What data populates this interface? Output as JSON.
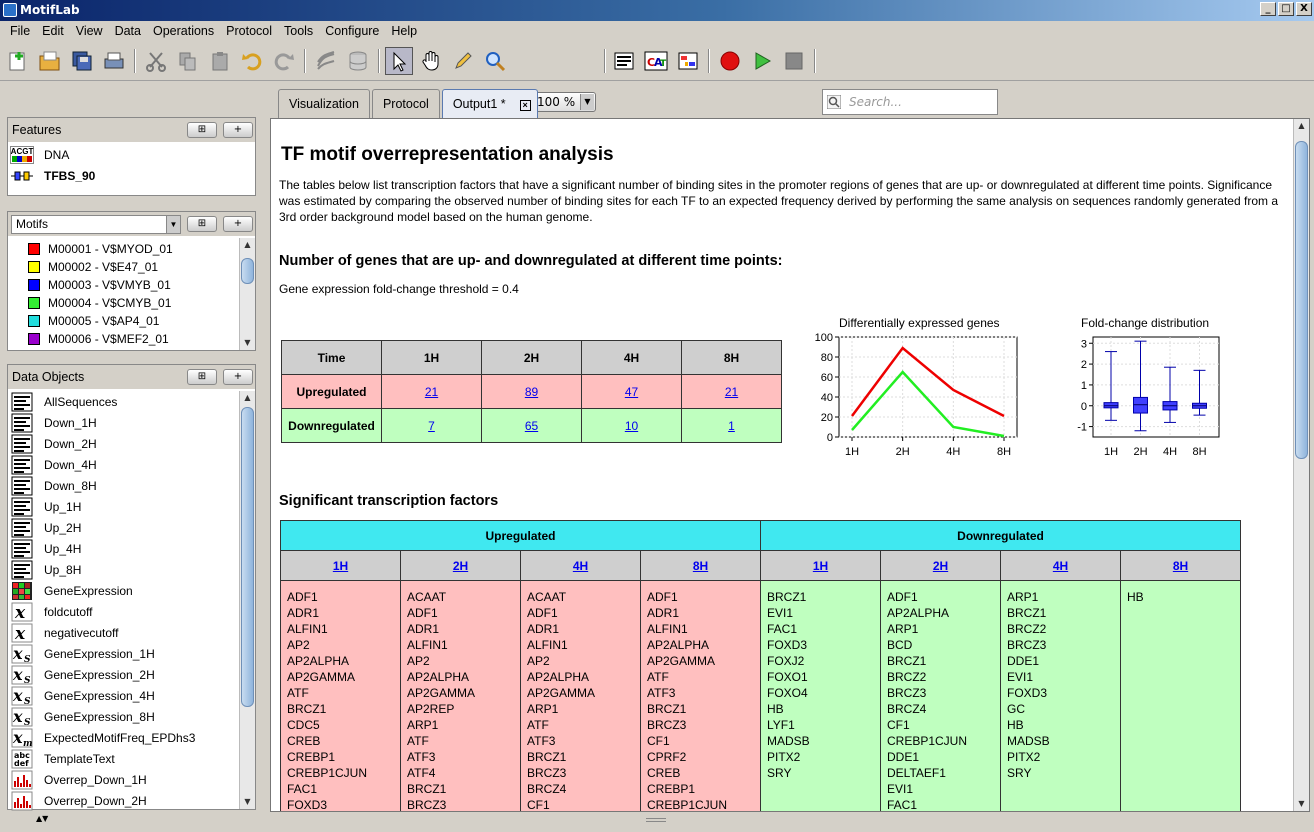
{
  "window": {
    "title": "MotifLab",
    "minimize": "_",
    "maximize": "□",
    "close": "X"
  },
  "menu": [
    "File",
    "Edit",
    "View",
    "Data",
    "Operations",
    "Protocol",
    "Tools",
    "Configure",
    "Help"
  ],
  "toolbar": {
    "zoom": "100 %",
    "search_placeholder": "Search..."
  },
  "features": {
    "title": "Features",
    "items": [
      {
        "label": "DNA",
        "icon": "dna-track-icon"
      },
      {
        "label": "TFBS_90",
        "icon": "region-track-icon"
      }
    ]
  },
  "motifs": {
    "selector": "Motifs",
    "items": [
      {
        "label": "M00001 - V$MYOD_01",
        "color": "#ff0000"
      },
      {
        "label": "M00002 - V$E47_01",
        "color": "#ffff00"
      },
      {
        "label": "M00003 - V$VMYB_01",
        "color": "#0000ff"
      },
      {
        "label": "M00004 - V$CMYB_01",
        "color": "#33ee33"
      },
      {
        "label": "M00005 - V$AP4_01",
        "color": "#22dddd"
      },
      {
        "label": "M00006 - V$MEF2_01",
        "color": "#9900cc"
      }
    ]
  },
  "data_objects": {
    "title": "Data Objects",
    "items": [
      {
        "label": "AllSequences",
        "icon": "sequence-collection-icon"
      },
      {
        "label": "Down_1H",
        "icon": "sequence-collection-icon"
      },
      {
        "label": "Down_2H",
        "icon": "sequence-collection-icon"
      },
      {
        "label": "Down_4H",
        "icon": "sequence-collection-icon"
      },
      {
        "label": "Down_8H",
        "icon": "sequence-collection-icon"
      },
      {
        "label": "Up_1H",
        "icon": "sequence-collection-icon"
      },
      {
        "label": "Up_2H",
        "icon": "sequence-collection-icon"
      },
      {
        "label": "Up_4H",
        "icon": "sequence-collection-icon"
      },
      {
        "label": "Up_8H",
        "icon": "sequence-collection-icon"
      },
      {
        "label": "GeneExpression",
        "icon": "expression-profile-icon"
      },
      {
        "label": "foldcutoff",
        "icon": "numeric-variable-icon"
      },
      {
        "label": "negativecutoff",
        "icon": "numeric-variable-icon"
      },
      {
        "label": "GeneExpression_1H",
        "icon": "sequence-numeric-map-icon"
      },
      {
        "label": "GeneExpression_2H",
        "icon": "sequence-numeric-map-icon"
      },
      {
        "label": "GeneExpression_4H",
        "icon": "sequence-numeric-map-icon"
      },
      {
        "label": "GeneExpression_8H",
        "icon": "sequence-numeric-map-icon"
      },
      {
        "label": "ExpectedMotifFreq_EPDhs3",
        "icon": "motif-numeric-map-icon"
      },
      {
        "label": "TemplateText",
        "icon": "text-variable-icon"
      },
      {
        "label": "Overrep_Down_1H",
        "icon": "analysis-icon"
      },
      {
        "label": "Overrep_Down_2H",
        "icon": "analysis-icon"
      }
    ]
  },
  "tabs": [
    {
      "label": "Visualization"
    },
    {
      "label": "Protocol"
    },
    {
      "label": "Output1 *"
    }
  ],
  "doc": {
    "title": "TF motif overrepresentation analysis",
    "intro": "The tables below list transcription factors that have a significant number of binding sites in the promoter regions of genes that are up- or downregulated at different time points. Significance was estimated by comparing the observed number of binding sites for each TF to an expected frequency derived by performing the same analysis on sequences randomly generated from a 3rd order background model based on the human genome.",
    "section1": "Number of genes that are up- and downregulated at different time points:",
    "threshold": "Gene expression fold-change threshold = 0.4",
    "genes_table": {
      "header": [
        "Time",
        "1H",
        "2H",
        "4H",
        "8H"
      ],
      "rows": [
        {
          "label": "Upregulated",
          "values": [
            "21",
            "89",
            "47",
            "21"
          ]
        },
        {
          "label": "Downregulated",
          "values": [
            "7",
            "65",
            "10",
            "1"
          ]
        }
      ]
    },
    "section2": "Significant transcription factors",
    "tf_table": {
      "groups": [
        "Upregulated",
        "Downregulated"
      ],
      "columns": [
        {
          "h": "1H",
          "items": [
            "ADF1",
            "ADR1",
            "ALFIN1",
            "AP2",
            "AP2ALPHA",
            "AP2GAMMA",
            "ATF",
            "BRCZ1",
            "CDC5",
            "CREB",
            "CREBP1",
            "CREBP1CJUN",
            "FAC1",
            "FOXD3"
          ]
        },
        {
          "h": "2H",
          "items": [
            "ACAAT",
            "ADF1",
            "ADR1",
            "ALFIN1",
            "AP2",
            "AP2ALPHA",
            "AP2GAMMA",
            "AP2REP",
            "ARP1",
            "ATF",
            "ATF3",
            "ATF4",
            "BRCZ1",
            "BRCZ3"
          ]
        },
        {
          "h": "4H",
          "items": [
            "ACAAT",
            "ADF1",
            "ADR1",
            "ALFIN1",
            "AP2",
            "AP2ALPHA",
            "AP2GAMMA",
            "ARP1",
            "ATF",
            "ATF3",
            "BRCZ1",
            "BRCZ3",
            "BRCZ4",
            "CF1"
          ]
        },
        {
          "h": "8H",
          "items": [
            "ADF1",
            "ADR1",
            "ALFIN1",
            "AP2ALPHA",
            "AP2GAMMA",
            "ATF",
            "ATF3",
            "BRCZ1",
            "BRCZ3",
            "CF1",
            "CPRF2",
            "CREB",
            "CREBP1",
            "CREBP1CJUN"
          ]
        },
        {
          "h": "1H",
          "items": [
            "BRCZ1",
            "EVI1",
            "FAC1",
            "FOXD3",
            "FOXJ2",
            "FOXO1",
            "FOXO4",
            "HB",
            "LYF1",
            "MADSB",
            "PITX2",
            "SRY"
          ]
        },
        {
          "h": "2H",
          "items": [
            "ADF1",
            "AP2ALPHA",
            "ARP1",
            "BCD",
            "BRCZ1",
            "BRCZ2",
            "BRCZ3",
            "BRCZ4",
            "CF1",
            "CREBP1CJUN",
            "DDE1",
            "DELTAEF1",
            "EVI1",
            "FAC1"
          ]
        },
        {
          "h": "4H",
          "items": [
            "ARP1",
            "BRCZ1",
            "BRCZ2",
            "BRCZ3",
            "DDE1",
            "EVI1",
            "FOXD3",
            "GC",
            "HB",
            "MADSB",
            "PITX2",
            "SRY"
          ]
        },
        {
          "h": "8H",
          "items": [
            "HB"
          ]
        }
      ]
    }
  },
  "chart_data": [
    {
      "type": "line",
      "title": "Differentially expressed genes",
      "categories": [
        "1H",
        "2H",
        "4H",
        "8H"
      ],
      "series": [
        {
          "values": [
            21,
            89,
            47,
            21
          ],
          "color": "#ee0000"
        },
        {
          "values": [
            7,
            65,
            10,
            1
          ],
          "color": "#22ee22"
        }
      ],
      "ylim": [
        0,
        100
      ],
      "yticks": [
        0,
        20,
        40,
        60,
        80,
        100
      ],
      "grid": true
    },
    {
      "type": "box",
      "title": "Fold-change distribution",
      "categories": [
        "1H",
        "2H",
        "4H",
        "8H"
      ],
      "boxes": [
        {
          "min": -0.7,
          "q1": -0.1,
          "median": 0,
          "q3": 0.15,
          "max": 2.6
        },
        {
          "min": -1.2,
          "q1": -0.35,
          "median": 0.05,
          "q3": 0.4,
          "max": 3.1
        },
        {
          "min": -0.8,
          "q1": -0.2,
          "median": 0,
          "q3": 0.2,
          "max": 1.85
        },
        {
          "min": -0.45,
          "q1": -0.12,
          "median": 0,
          "q3": 0.12,
          "max": 1.7
        }
      ],
      "ylim": [
        -1.5,
        3.3
      ],
      "yticks": [
        -1,
        0,
        1,
        2,
        3
      ],
      "grid": true,
      "color": "#4040ff"
    }
  ]
}
